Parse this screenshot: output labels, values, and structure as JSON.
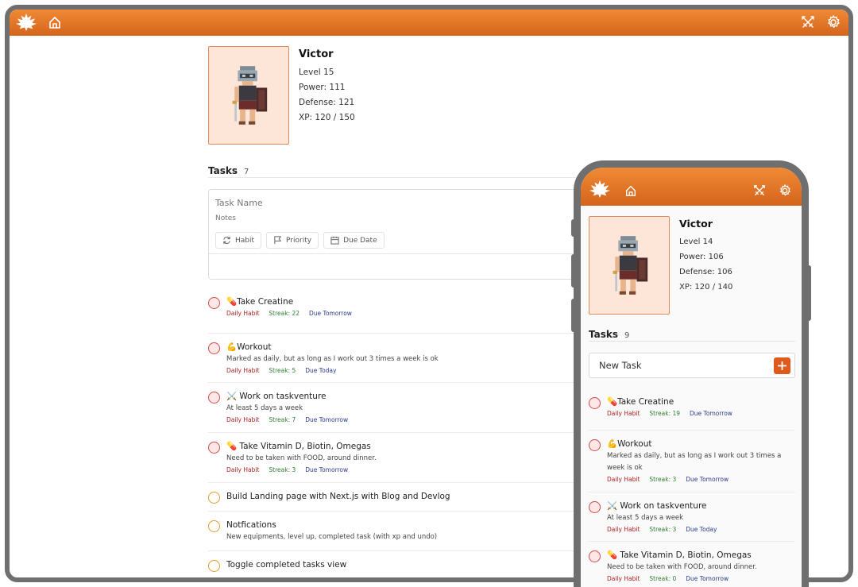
{
  "desktop": {
    "topbar": {
      "logo_icon": "maple-leaf-logo-icon",
      "home_icon": "home-icon",
      "swords_icon": "crossed-swords-icon",
      "settings_icon": "gear-icon"
    },
    "profile": {
      "name": "Victor",
      "level": "Level 15",
      "power": "Power: 111",
      "defense": "Defense: 121",
      "xp": "XP: 120 / 150"
    },
    "tasks": {
      "heading": "Tasks",
      "count": "7",
      "new_task": {
        "name_placeholder": "Task Name",
        "notes_placeholder": "Notes",
        "options": [
          "Habit",
          "Priority",
          "Due Date"
        ]
      },
      "items": [
        {
          "title": "💊Take Creatine",
          "note": "",
          "type": "Daily Habit",
          "streak": "Streak: 22",
          "due": "Due Tomorrow",
          "status": "red"
        },
        {
          "title": "💪Workout",
          "note": "Marked as daily, but as long as I work out 3 times a week is ok",
          "type": "Daily Habit",
          "streak": "Streak: 5",
          "due": "Due Today",
          "status": "red"
        },
        {
          "title": "⚔️ Work on taskventure",
          "note": "At least 5 days a week",
          "type": "Daily Habit",
          "streak": "Streak: 7",
          "due": "Due Tomorrow",
          "status": "red"
        },
        {
          "title": "💊 Take Vitamin D, Biotin, Omegas",
          "note": "Need to be taken with FOOD, around dinner.",
          "type": "Daily Habit",
          "streak": "Streak: 3",
          "due": "Due Tomorrow",
          "status": "red"
        },
        {
          "title": "Build Landing page with Next.js with Blog and Devlog",
          "note": "",
          "type": "",
          "streak": "",
          "due": "",
          "status": "orange"
        },
        {
          "title": "Notfications",
          "note": "New equipments, level up, completed task (with xp and undo)",
          "type": "",
          "streak": "",
          "due": "",
          "status": "orange"
        },
        {
          "title": "Toggle completed tasks view",
          "note": "",
          "type": "",
          "streak": "",
          "due": "",
          "status": "orange"
        }
      ]
    }
  },
  "phone": {
    "profile": {
      "name": "Victor",
      "level": "Level 14",
      "power": "Power: 106",
      "defense": "Defense: 106",
      "xp": "XP: 120 / 140"
    },
    "tasks": {
      "heading": "Tasks",
      "count": "9",
      "new_task_label": "New Task",
      "items": [
        {
          "title": "💊Take Creatine",
          "note": "",
          "type": "Daily Habit",
          "streak": "Streak: 19",
          "due": "Due Tomorrow"
        },
        {
          "title": "💪Workout",
          "note": "Marked as daily, but as long as I work out 3 times a week is ok",
          "type": "Daily Habit",
          "streak": "Streak: 3",
          "due": "Due Tomorrow"
        },
        {
          "title": "⚔️ Work on taskventure",
          "note": "At least 5 days a week",
          "type": "Daily Habit",
          "streak": "Streak: 3",
          "due": "Due Today"
        },
        {
          "title": "💊 Take Vitamin D, Biotin, Omegas",
          "note": "Need to be taken with FOOD, around dinner.",
          "type": "Daily Habit",
          "streak": "Streak: 0",
          "due": "Due Tomorrow"
        }
      ]
    }
  },
  "colors": {
    "accent_top": "#f08a35",
    "accent_bottom": "#d4641c",
    "habit": "#b12020",
    "streak": "#2f7d32",
    "due": "#2b3a8c"
  }
}
